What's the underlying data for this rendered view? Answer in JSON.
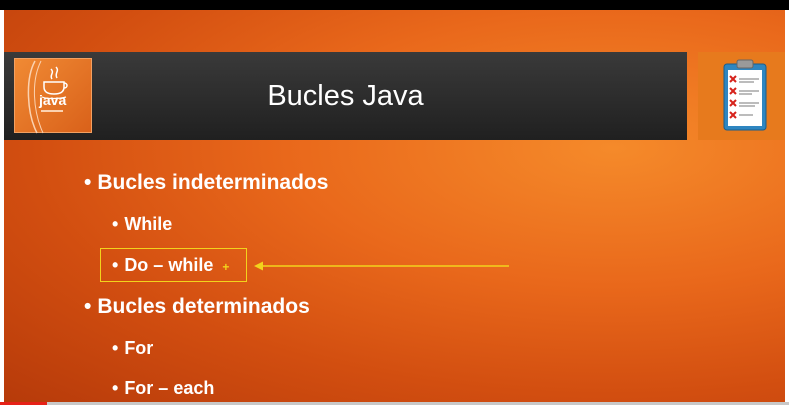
{
  "slide": {
    "title": "Bucles Java",
    "logo_text": "java",
    "bullets": [
      {
        "text": "Bucles indeterminados",
        "level": 1
      },
      {
        "text": "While",
        "level": 2
      },
      {
        "text": "Do – while",
        "level": 2,
        "highlighted": true
      },
      {
        "text": "Bucles determinados",
        "level": 1
      },
      {
        "text": "For",
        "level": 2
      },
      {
        "text": "For – each",
        "level": 2
      }
    ],
    "bullet_char": "•",
    "cursor_char": "+"
  },
  "colors": {
    "slide_background": "#e06a1c",
    "title_bar": "#2a2a2a",
    "highlight_box": "#f2d31c",
    "arrow": "#f2d31c",
    "progress": "#e62117"
  },
  "icons": {
    "logo": "java-logo-icon",
    "clipboard": "clipboard-checklist-icon",
    "arrow": "arrow-left-icon"
  },
  "video": {
    "progress": 0.06
  }
}
